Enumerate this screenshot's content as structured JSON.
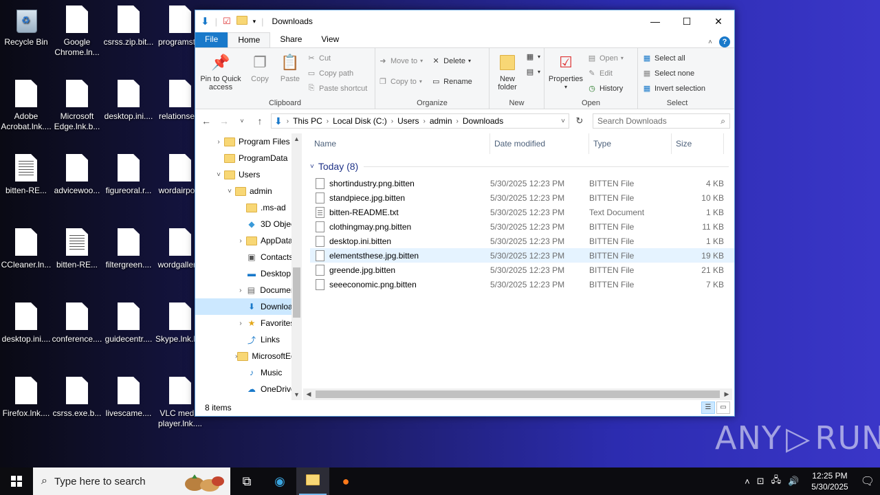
{
  "desktop": {
    "icons": [
      {
        "label": "Recycle Bin",
        "type": "bin"
      },
      {
        "label": "Google Chrome.ln...",
        "type": "doc"
      },
      {
        "label": "csrss.zip.bit...",
        "type": "doc"
      },
      {
        "label": "programst...",
        "type": "doc"
      },
      {
        "label": "Adobe Acrobat.lnk....",
        "type": "doc"
      },
      {
        "label": "Microsoft Edge.lnk.b...",
        "type": "doc"
      },
      {
        "label": "desktop.ini....",
        "type": "doc"
      },
      {
        "label": "relationse...",
        "type": "doc"
      },
      {
        "label": "bitten-RE...",
        "type": "lines"
      },
      {
        "label": "advicewoo...",
        "type": "doc"
      },
      {
        "label": "figureoral.r...",
        "type": "doc"
      },
      {
        "label": "wordairpo...",
        "type": "doc"
      },
      {
        "label": "CCleaner.ln...",
        "type": "doc"
      },
      {
        "label": "bitten-RE...",
        "type": "lines"
      },
      {
        "label": "filtergreen....",
        "type": "doc"
      },
      {
        "label": "wordgaller...",
        "type": "doc"
      },
      {
        "label": "desktop.ini....",
        "type": "doc"
      },
      {
        "label": "conference....",
        "type": "doc"
      },
      {
        "label": "guidecentr....",
        "type": "doc"
      },
      {
        "label": "Skype.lnk.b...",
        "type": "doc"
      },
      {
        "label": "Firefox.lnk....",
        "type": "doc"
      },
      {
        "label": "csrss.exe.b...",
        "type": "doc"
      },
      {
        "label": "livescame....",
        "type": "doc"
      },
      {
        "label": "VLC media player.lnk....",
        "type": "doc"
      }
    ]
  },
  "window": {
    "title": "Downloads",
    "tabs": {
      "file": "File",
      "home": "Home",
      "share": "Share",
      "view": "View"
    },
    "ribbon": {
      "clipboard": {
        "label": "Clipboard",
        "pin": "Pin to Quick access",
        "copy": "Copy",
        "paste": "Paste",
        "cut": "Cut",
        "copy_path": "Copy path",
        "paste_shortcut": "Paste shortcut"
      },
      "organize": {
        "label": "Organize",
        "move_to": "Move to",
        "copy_to": "Copy to",
        "delete": "Delete",
        "rename": "Rename"
      },
      "new": {
        "label": "New",
        "new_folder": "New folder"
      },
      "open": {
        "label": "Open",
        "properties": "Properties",
        "open": "Open",
        "edit": "Edit",
        "history": "History"
      },
      "select": {
        "label": "Select",
        "select_all": "Select all",
        "select_none": "Select none",
        "invert": "Invert selection"
      }
    },
    "address": {
      "crumbs": [
        "This PC",
        "Local Disk (C:)",
        "Users",
        "admin",
        "Downloads"
      ],
      "search_placeholder": "Search Downloads"
    },
    "nav": [
      {
        "label": "Program Files",
        "exp": "›",
        "indent": 1,
        "icon": "folder"
      },
      {
        "label": "ProgramData",
        "exp": "",
        "indent": 1,
        "icon": "folder"
      },
      {
        "label": "Users",
        "exp": "˅",
        "indent": 1,
        "icon": "folder"
      },
      {
        "label": "admin",
        "exp": "˅",
        "indent": 2,
        "icon": "folder"
      },
      {
        "label": ".ms-ad",
        "exp": "",
        "indent": 3,
        "icon": "folder"
      },
      {
        "label": "3D Objects",
        "exp": "",
        "indent": 3,
        "icon": "cube"
      },
      {
        "label": "AppData",
        "exp": "›",
        "indent": 3,
        "icon": "folder"
      },
      {
        "label": "Contacts",
        "exp": "",
        "indent": 3,
        "icon": "contacts"
      },
      {
        "label": "Desktop",
        "exp": "",
        "indent": 3,
        "icon": "desktop"
      },
      {
        "label": "Documents",
        "exp": "›",
        "indent": 3,
        "icon": "documents"
      },
      {
        "label": "Downloads",
        "exp": "",
        "indent": 3,
        "icon": "download",
        "selected": true
      },
      {
        "label": "Favorites",
        "exp": "›",
        "indent": 3,
        "icon": "star"
      },
      {
        "label": "Links",
        "exp": "",
        "indent": 3,
        "icon": "link"
      },
      {
        "label": "MicrosoftEdge",
        "exp": "›",
        "indent": 3,
        "icon": "folder"
      },
      {
        "label": "Music",
        "exp": "",
        "indent": 3,
        "icon": "music"
      },
      {
        "label": "OneDrive",
        "exp": "",
        "indent": 3,
        "icon": "cloud"
      }
    ],
    "columns": {
      "name": "Name",
      "date": "Date modified",
      "type": "Type",
      "size": "Size"
    },
    "group": "Today (8)",
    "files": [
      {
        "name": "shortindustry.png.bitten",
        "date": "5/30/2025 12:23 PM",
        "type": "BITTEN File",
        "size": "4 KB"
      },
      {
        "name": "standpiece.jpg.bitten",
        "date": "5/30/2025 12:23 PM",
        "type": "BITTEN File",
        "size": "10 KB"
      },
      {
        "name": "bitten-README.txt",
        "date": "5/30/2025 12:23 PM",
        "type": "Text Document",
        "size": "1 KB",
        "txt": true
      },
      {
        "name": "clothingmay.png.bitten",
        "date": "5/30/2025 12:23 PM",
        "type": "BITTEN File",
        "size": "11 KB"
      },
      {
        "name": "desktop.ini.bitten",
        "date": "5/30/2025 12:23 PM",
        "type": "BITTEN File",
        "size": "1 KB"
      },
      {
        "name": "elementsthese.jpg.bitten",
        "date": "5/30/2025 12:23 PM",
        "type": "BITTEN File",
        "size": "19 KB",
        "hover": true
      },
      {
        "name": "greende.jpg.bitten",
        "date": "5/30/2025 12:23 PM",
        "type": "BITTEN File",
        "size": "21 KB"
      },
      {
        "name": "seeeconomic.png.bitten",
        "date": "5/30/2025 12:23 PM",
        "type": "BITTEN File",
        "size": "7 KB"
      }
    ],
    "status": "8 items"
  },
  "taskbar": {
    "search_placeholder": "Type here to search",
    "time": "12:25 PM",
    "date": "5/30/2025"
  },
  "watermark": {
    "left": "ANY",
    "right": "RUN"
  },
  "colors": {
    "accent": "#1979ca",
    "selection": "#cce8ff",
    "hover": "#e5f3ff"
  }
}
